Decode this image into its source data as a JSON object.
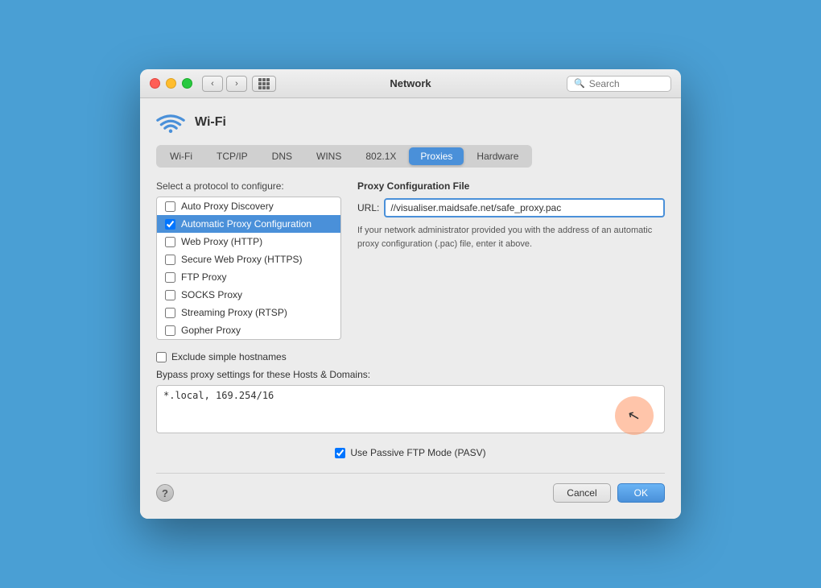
{
  "titlebar": {
    "title": "Network",
    "search_placeholder": "Search"
  },
  "wifi": {
    "label": "Wi-Fi"
  },
  "tabs": [
    {
      "id": "wifi",
      "label": "Wi-Fi"
    },
    {
      "id": "tcpip",
      "label": "TCP/IP"
    },
    {
      "id": "dns",
      "label": "DNS"
    },
    {
      "id": "wins",
      "label": "WINS"
    },
    {
      "id": "8021x",
      "label": "802.1X"
    },
    {
      "id": "proxies",
      "label": "Proxies"
    },
    {
      "id": "hardware",
      "label": "Hardware"
    }
  ],
  "protocol_section": {
    "label": "Select a protocol to configure:",
    "items": [
      {
        "id": "auto-proxy-discovery",
        "label": "Auto Proxy Discovery",
        "checked": false,
        "selected": false
      },
      {
        "id": "automatic-proxy-configuration",
        "label": "Automatic Proxy Configuration",
        "checked": true,
        "selected": true
      },
      {
        "id": "web-proxy-http",
        "label": "Web Proxy (HTTP)",
        "checked": false,
        "selected": false
      },
      {
        "id": "secure-web-proxy-https",
        "label": "Secure Web Proxy (HTTPS)",
        "checked": false,
        "selected": false
      },
      {
        "id": "ftp-proxy",
        "label": "FTP Proxy",
        "checked": false,
        "selected": false
      },
      {
        "id": "socks-proxy",
        "label": "SOCKS Proxy",
        "checked": false,
        "selected": false
      },
      {
        "id": "streaming-proxy-rtsp",
        "label": "Streaming Proxy (RTSP)",
        "checked": false,
        "selected": false
      },
      {
        "id": "gopher-proxy",
        "label": "Gopher Proxy",
        "checked": false,
        "selected": false
      }
    ]
  },
  "proxy_config": {
    "title": "Proxy Configuration File",
    "url_label": "URL:",
    "url_value": "//visualiser.maidsafe.net/safe_proxy.pac",
    "description": "If your network administrator provided you with the address of an automatic proxy configuration (.pac) file, enter it above."
  },
  "exclude_label": "Exclude simple hostnames",
  "bypass_label": "Bypass proxy settings for these Hosts & Domains:",
  "bypass_value": "*.local, 169.254/16",
  "passive_ftp_label": "Use Passive FTP Mode (PASV)",
  "footer": {
    "cancel_label": "Cancel",
    "ok_label": "OK"
  }
}
